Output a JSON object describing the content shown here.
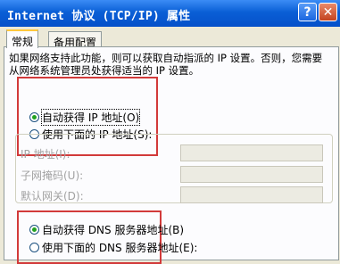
{
  "window": {
    "title": "Internet 协议 (TCP/IP) 属性",
    "help_label": "?",
    "close_label": "✕"
  },
  "tabs": [
    {
      "label": "常规",
      "active": true
    },
    {
      "label": "备用配置",
      "active": false
    }
  ],
  "description": "如果网络支持此功能，则可以获取自动指派的 IP 设置。否则，您需要从网络系统管理员处获得适当的 IP 设置。",
  "ip_mode": {
    "auto": {
      "label": "自动获得 IP 地址(O)",
      "checked": true
    },
    "manual": {
      "label": "使用下面的 IP 地址(S):",
      "checked": false
    }
  },
  "ip_fields": [
    {
      "label": "IP 地址(I):",
      "value": ""
    },
    {
      "label": "子网掩码(U):",
      "value": ""
    },
    {
      "label": "默认网关(D):",
      "value": ""
    }
  ],
  "dns_mode": {
    "auto": {
      "label": "自动获得 DNS 服务器地址(B)",
      "checked": true
    },
    "manual": {
      "label": "使用下面的 DNS 服务器地址(E):",
      "checked": false
    }
  },
  "colors": {
    "title_bar": "#0a5fd6",
    "highlight_box": "#d23a3a",
    "radio_dot": "#21a121"
  }
}
